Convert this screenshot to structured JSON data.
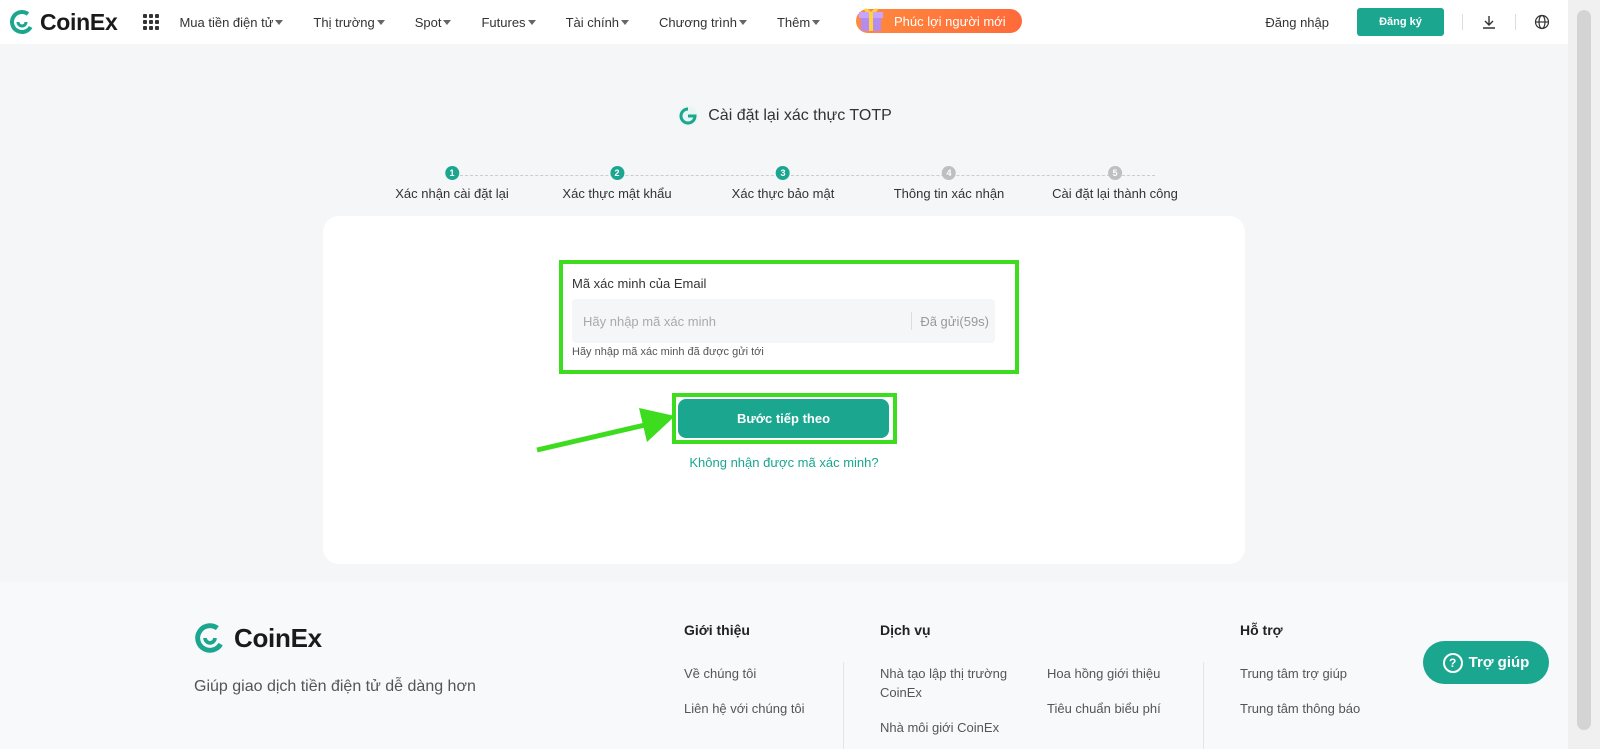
{
  "header": {
    "brand": "CoinEx",
    "nav": [
      {
        "label": "Mua tiền điện tử"
      },
      {
        "label": "Thị trường"
      },
      {
        "label": "Spot"
      },
      {
        "label": "Futures"
      },
      {
        "label": "Tài chính"
      },
      {
        "label": "Chương trình"
      },
      {
        "label": "Thêm"
      }
    ],
    "promo_label": "Phúc lợi người mới",
    "login_label": "Đăng nhập",
    "signup_label": "Đăng ký"
  },
  "page": {
    "title": "Cài đặt lại xác thực TOTP",
    "steps": [
      {
        "num": "1",
        "label": "Xác nhận cài đặt lại",
        "state": "done"
      },
      {
        "num": "2",
        "label": "Xác thực mật khẩu",
        "state": "done"
      },
      {
        "num": "3",
        "label": "Xác thực bảo mật",
        "state": "active"
      },
      {
        "num": "4",
        "label": "Thông tin xác nhận",
        "state": "todo"
      },
      {
        "num": "5",
        "label": "Cài đặt lại thành công",
        "state": "todo"
      }
    ]
  },
  "form": {
    "field_label": "Mã xác minh của Email",
    "input_placeholder": "Hãy nhập mã xác minh",
    "input_value": "",
    "resend_label": "Đã gửi(59s)",
    "hint": "Hãy nhập mã xác minh đã được gửi tới",
    "next_label": "Bước tiếp theo",
    "no_code_link": "Không nhận được mã xác minh?"
  },
  "footer": {
    "brand": "CoinEx",
    "tagline": "Giúp giao dịch tiền điện tử dễ dàng hơn",
    "col_about": {
      "title": "Giới thiệu",
      "links": [
        "Về chúng tôi",
        "Liên hệ với chúng tôi"
      ]
    },
    "col_services": {
      "title": "Dịch vụ",
      "links": [
        "Nhà tạo lập thị trường CoinEx",
        "Nhà môi giới CoinEx",
        "Hoa hồng giới thiệu",
        "Tiêu chuẩn biểu phí"
      ]
    },
    "col_support": {
      "title": "Hỗ trợ",
      "links": [
        "Trung tâm trợ giúp",
        "Trung tâm thông báo"
      ]
    }
  },
  "help_button": "Trợ giúp",
  "colors": {
    "brand": "#1aa68f",
    "highlight": "#3ddc1e",
    "promo": "#ff7a3a"
  },
  "icons": [
    "coinex-logo-icon",
    "apps-grid-icon",
    "gift-icon",
    "download-icon",
    "globe-icon",
    "google-authenticator-icon",
    "arrow-annotation-icon",
    "question-icon"
  ]
}
